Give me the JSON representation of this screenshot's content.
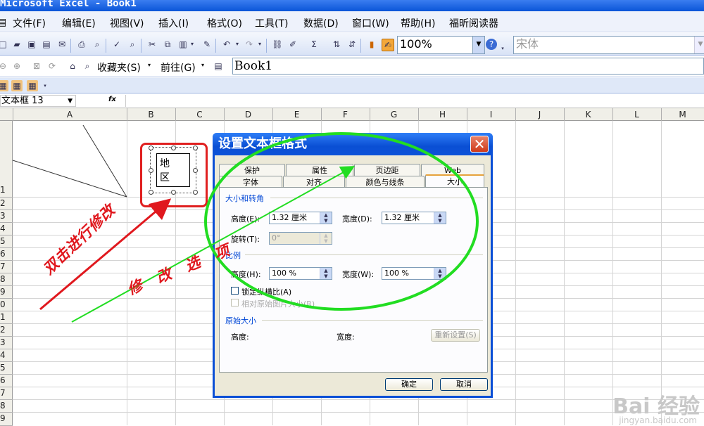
{
  "window": {
    "title": "Microsoft Excel - Book1"
  },
  "menubar": {
    "items": [
      "文件(F)",
      "编辑(E)",
      "视图(V)",
      "插入(I)",
      "格式(O)",
      "工具(T)",
      "数据(D)",
      "窗口(W)",
      "帮助(H)",
      "福昕阅读器"
    ]
  },
  "toolbar": {
    "zoom": "100%",
    "font": "宋体",
    "favorites": "收藏夹(S)",
    "goto": "前往(G)",
    "address": "Book1"
  },
  "formula_bar": {
    "name_box": "文本框 13",
    "fx": "fx"
  },
  "sheet": {
    "columns": [
      "A",
      "B",
      "C",
      "D",
      "E",
      "F",
      "G",
      "H",
      "I",
      "J",
      "K",
      "L",
      "M"
    ],
    "rows": [
      "1",
      "2",
      "3",
      "4",
      "5",
      "6",
      "7",
      "8",
      "9",
      "0",
      "1",
      "2",
      "3",
      "4",
      "5",
      "6",
      "7",
      "8",
      "9"
    ],
    "textbox_text": "地区"
  },
  "dialog": {
    "title": "设置文本框格式",
    "tabs_row1": [
      "保护",
      "属性",
      "页边距",
      "Web"
    ],
    "tabs_row2": [
      "字体",
      "对齐",
      "颜色与线条",
      "大小"
    ],
    "active_tab": "大小",
    "size_section": "大小和转角",
    "height_label": "高度(E):",
    "height_value": "1.32 厘米",
    "width_label": "宽度(D):",
    "width_value": "1.32 厘米",
    "rotation_label": "旋转(T):",
    "rotation_value": "0°",
    "scale_section": "比例",
    "scale_height_label": "高度(H):",
    "scale_height_value": "100 %",
    "scale_width_label": "宽度(W):",
    "scale_width_value": "100 %",
    "lock_aspect_label": "锁定纵横比(A)",
    "relative_label": "相对原始图片大小(R)",
    "original_section": "原始大小",
    "orig_height_label": "高度:",
    "orig_width_label": "宽度:",
    "reset_label": "重新设置(S)",
    "ok_label": "确定",
    "cancel_label": "取消"
  },
  "annotations": {
    "double_click": "双击进行修改",
    "modify_options": "修 改 选 项"
  },
  "watermark": {
    "main": "Bai 经验",
    "sub": "jingyan.baidu.com"
  },
  "colors": {
    "annotation_red": "#e0181e",
    "annotation_green": "#22dd22",
    "dialog_blue": "#0a4fd4"
  }
}
